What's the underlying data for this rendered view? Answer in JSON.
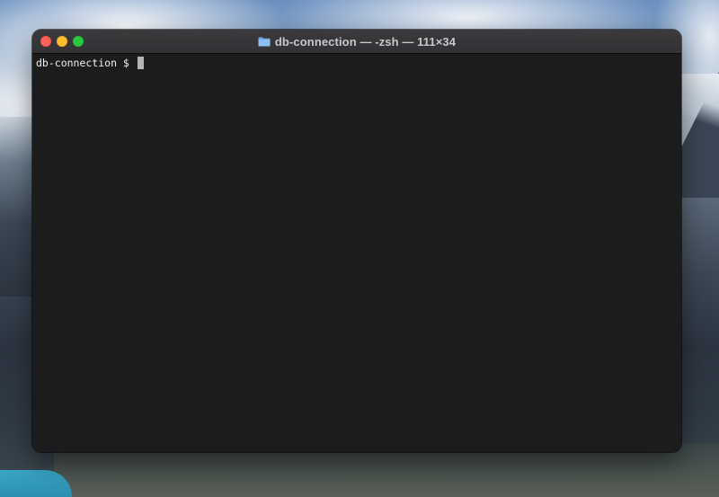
{
  "window": {
    "title": "db-connection — -zsh — 111×34",
    "folder_icon": "folder-icon"
  },
  "traffic_lights": {
    "close_color": "#fe5f57",
    "minimize_color": "#febc2e",
    "zoom_color": "#28c840"
  },
  "terminal": {
    "prompt": "db-connection $ ",
    "input": "",
    "background": "#1c1b1d",
    "foreground": "#f2f2f2"
  }
}
